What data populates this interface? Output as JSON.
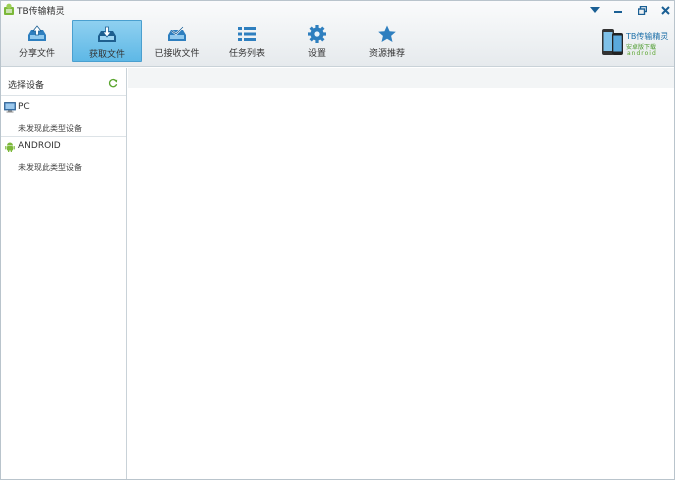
{
  "app": {
    "title": "TB传输精灵"
  },
  "toolbar": {
    "items": [
      {
        "label": "分享文件",
        "icon": "share-upload-icon",
        "active": false
      },
      {
        "label": "获取文件",
        "icon": "fetch-download-icon",
        "active": true
      },
      {
        "label": "已接收文件",
        "icon": "received-files-icon",
        "active": false
      },
      {
        "label": "任务列表",
        "icon": "task-list-icon",
        "active": false
      },
      {
        "label": "设置",
        "icon": "gear-icon",
        "active": false
      },
      {
        "label": "资源推荐",
        "icon": "star-icon",
        "active": false
      }
    ]
  },
  "brand": {
    "title": "TB传输精灵",
    "subtitle": "安卓版下载",
    "android": "android"
  },
  "sidebar": {
    "title": "选择设备",
    "groups": [
      {
        "name": "PC",
        "note": "未发现此类型设备",
        "icon": "pc-monitor-icon"
      },
      {
        "name": "ANDROID",
        "note": "未发现此类型设备",
        "icon": "android-icon"
      }
    ]
  },
  "colors": {
    "accent": "#5eb8e6",
    "icon_blue": "#1a5f94",
    "android_green": "#7cb83a"
  }
}
